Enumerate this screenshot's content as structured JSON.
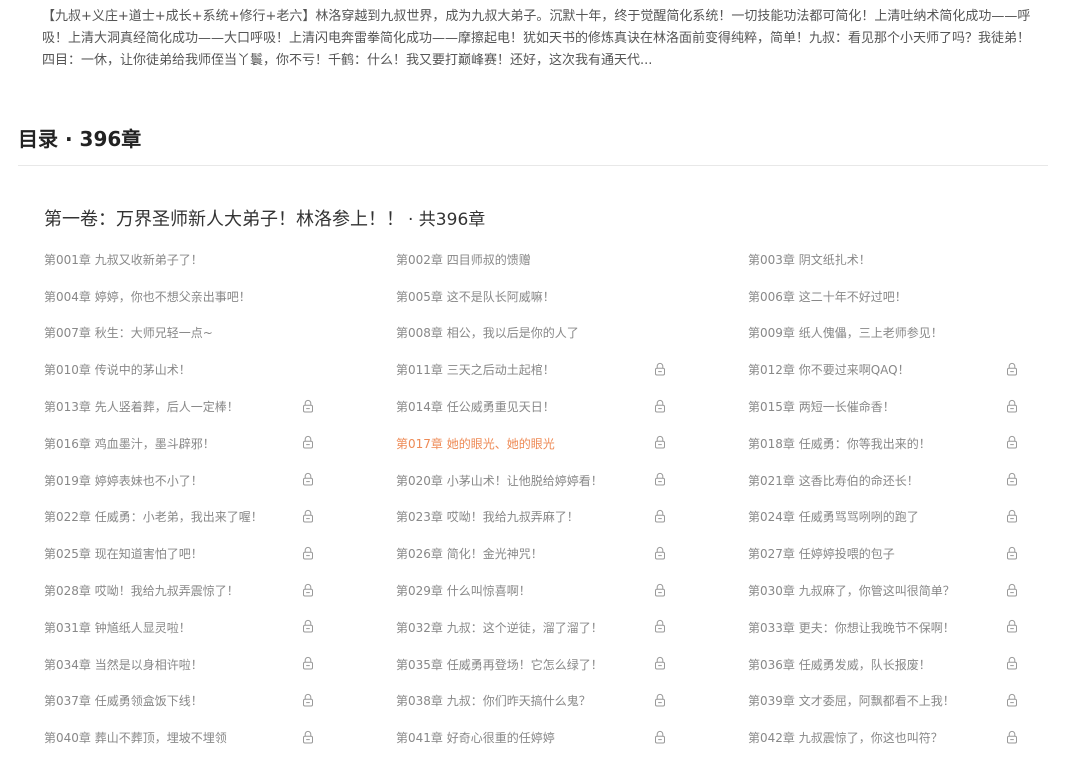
{
  "synopsis": "【九叔+义庄+道士+成长+系统+修行+老六】林洛穿越到九叔世界，成为九叔大弟子。沉默十年，终于觉醒简化系统！一切技能功法都可简化！上清吐纳术简化成功——呼吸！上清大洞真经简化成功——大口呼吸！上清闪电奔雷拳简化成功——摩擦起电！犹如天书的修炼真诀在林洛面前变得纯粹，简单！九叔：看见那个小天师了吗？我徒弟！四目：一休，让你徒弟给我师侄当丫鬟，你不亏！千鹤：什么！我又要打巅峰赛！还好，这次我有通天代...",
  "toc": {
    "heading": "目录 · 396章"
  },
  "volume": {
    "title": "第一卷：万界圣师新人大弟子！林洛参上！！",
    "count": "· 共396章"
  },
  "chapters": [
    {
      "title": "第001章 九叔又收新弟子了！",
      "locked": false
    },
    {
      "title": "第002章 四目师叔的馈赠",
      "locked": false
    },
    {
      "title": "第003章 阴文纸扎术！",
      "locked": false
    },
    {
      "title": "第004章 婷婷，你也不想父亲出事吧！",
      "locked": false
    },
    {
      "title": "第005章 这不是队长阿威嘛！",
      "locked": false
    },
    {
      "title": "第006章 这二十年不好过吧！",
      "locked": false
    },
    {
      "title": "第007章 秋生：大师兄轻一点~",
      "locked": false
    },
    {
      "title": "第008章 相公，我以后是你的人了",
      "locked": false
    },
    {
      "title": "第009章 纸人傀儡，三上老师参见！",
      "locked": false
    },
    {
      "title": "第010章 传说中的茅山术！",
      "locked": false
    },
    {
      "title": "第011章 三天之后动土起棺！",
      "locked": true
    },
    {
      "title": "第012章 你不要过来啊QAQ！",
      "locked": true
    },
    {
      "title": "第013章 先人竖着葬，后人一定棒！",
      "locked": true
    },
    {
      "title": "第014章 任公威勇重见天日！",
      "locked": true
    },
    {
      "title": "第015章 两短一长催命香！",
      "locked": true
    },
    {
      "title": "第016章 鸡血墨汁，墨斗辟邪！",
      "locked": true
    },
    {
      "title": "第017章 她的眼光、她的眼光",
      "locked": true,
      "current": true
    },
    {
      "title": "第018章 任威勇：你等我出来的！",
      "locked": true
    },
    {
      "title": "第019章 婷婷表妹也不小了！",
      "locked": true
    },
    {
      "title": "第020章 小茅山术！让他脱给婷婷看！",
      "locked": true
    },
    {
      "title": "第021章 这香比寿伯的命还长！",
      "locked": true
    },
    {
      "title": "第022章 任威勇：小老弟，我出来了喔！",
      "locked": true
    },
    {
      "title": "第023章 哎呦！我给九叔弄麻了！",
      "locked": true
    },
    {
      "title": "第024章 任威勇骂骂咧咧的跑了",
      "locked": true
    },
    {
      "title": "第025章 现在知道害怕了吧！",
      "locked": true
    },
    {
      "title": "第026章 简化！金光神咒！",
      "locked": true
    },
    {
      "title": "第027章 任婷婷投喂的包子",
      "locked": true
    },
    {
      "title": "第028章 哎呦！我给九叔弄震惊了！",
      "locked": true
    },
    {
      "title": "第029章 什么叫惊喜啊！",
      "locked": true
    },
    {
      "title": "第030章 九叔麻了，你管这叫很简单？",
      "locked": true
    },
    {
      "title": "第031章 钟馗纸人显灵啦！",
      "locked": true
    },
    {
      "title": "第032章 九叔：这个逆徒，溜了溜了！",
      "locked": true
    },
    {
      "title": "第033章 更夫：你想让我晚节不保啊！",
      "locked": true
    },
    {
      "title": "第034章 当然是以身相许啦！",
      "locked": true
    },
    {
      "title": "第035章 任威勇再登场！它怎么绿了！",
      "locked": true
    },
    {
      "title": "第036章 任威勇发威，队长报废！",
      "locked": true
    },
    {
      "title": "第037章 任威勇领盒饭下线！",
      "locked": true
    },
    {
      "title": "第038章 九叔：你们昨天搞什么鬼？",
      "locked": true
    },
    {
      "title": "第039章 文才委屈，阿飘都看不上我！",
      "locked": true
    },
    {
      "title": "第040章 葬山不葬顶，埋坡不埋领",
      "locked": true
    },
    {
      "title": "第041章 好奇心很重的任婷婷",
      "locked": true
    },
    {
      "title": "第042章 九叔震惊了，你这也叫符？",
      "locked": true
    }
  ]
}
